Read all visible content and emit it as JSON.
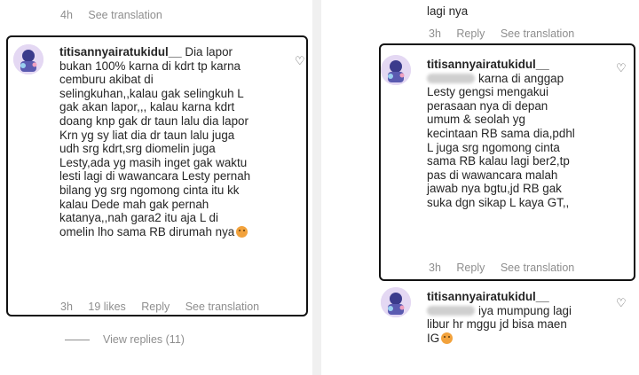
{
  "left": {
    "top_meta": {
      "time": "4h",
      "translation": "See translation"
    },
    "comment": {
      "username": "titisannyairatukidul__",
      "text": " Dia lapor\nbukan 100% karna di kdrt tp karna\ncemburu akibat di\nselingkuhan,,kalau gak selingkuh L\ngak akan lapor,,, kalau karna kdrt\ndoang knp gak dr taun lalu dia lapor\nKrn yg sy liat dia dr taun lalu juga\nudh srg kdrt,srg diomelin juga\nLesty,ada yg masih inget gak waktu\nlesti lagi di wawancara Lesty pernah\nbilang yg srg ngomong cinta itu kk\nkalau Dede mah gak pernah\nkatanya,,nah gara2 itu aja L di\nomelin lho sama RB dirumah nya",
      "time": "3h",
      "likes": "19 likes",
      "reply": "Reply",
      "translation": "See translation"
    },
    "view_replies": "View replies (11)"
  },
  "right": {
    "top_text": "lagi nya",
    "top_meta": {
      "time": "3h",
      "reply": "Reply",
      "translation": "See translation"
    },
    "comment1": {
      "username": "titisannyairatukidul__",
      "text_first": "karna di anggap",
      "text": "Lesty gengsi mengakui\nperasaan nya di depan\numum & seolah yg\nkecintaan RB sama dia,pdhl\nL juga srg ngomong cinta\nsama RB kalau lagi ber2,tp\npas di wawancara malah\njawab nya bgtu,jd RB gak\nsuka dgn sikap L kaya GT,,",
      "time": "3h",
      "reply": "Reply",
      "translation": "See translation"
    },
    "comment2": {
      "username": "titisannyairatukidul__",
      "text_first": "iya mumpung lagi",
      "text": "libur hr mggu jd bisa maen\nIG"
    }
  },
  "colors": {
    "meta": "#8e8e8e",
    "text": "#262626",
    "highlight_border": "#111111"
  },
  "icons": {
    "like": "heart-outline-icon",
    "emoji": "smiling-face-emoji-icon"
  }
}
